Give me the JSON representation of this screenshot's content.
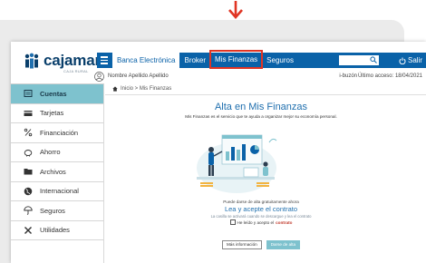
{
  "brand": {
    "name": "cajamar",
    "subtitle": "CAJA RURAL"
  },
  "nav": {
    "items": [
      "Banca Electrónica",
      "Broker",
      "Mis Finanzas",
      "Seguros"
    ],
    "logout": "Salir",
    "highlight_color": "#e03524"
  },
  "user": {
    "name": "Nombre Apellido Apellido",
    "ibuzon": "i-buzón",
    "last_access": "Último acceso: 18/04/2021"
  },
  "sidebar": {
    "items": [
      {
        "label": "Cuentas",
        "icon": "wallet-icon",
        "active": true
      },
      {
        "label": "Tarjetas",
        "icon": "card-icon"
      },
      {
        "label": "Financiación",
        "icon": "percent-icon"
      },
      {
        "label": "Ahorro",
        "icon": "piggy-bank-icon"
      },
      {
        "label": "Archivos",
        "icon": "folder-icon"
      },
      {
        "label": "Internacional",
        "icon": "globe-icon"
      },
      {
        "label": "Seguros",
        "icon": "umbrella-icon"
      },
      {
        "label": "Utilidades",
        "icon": "tools-icon"
      }
    ]
  },
  "breadcrumb": "Inicio > Mis Finanzas",
  "main": {
    "title": "Alta en Mis Finanzas",
    "subtitle": "Mis Finanzas es el servicio que te ayuda a organizar mejor su economía personal.",
    "free_text": "Puede darse de alta gratuitamente ahora",
    "contract_link": "Lea y acepte el contrato",
    "contract_note": "La casilla se activará cuando se descargue y lea el contrato",
    "accept_text": "He leído y acepto el",
    "accept_link": "contrato",
    "more_info_button": "Más información",
    "signup_button": "Darse de alta"
  },
  "colors": {
    "primary": "#0a62a8",
    "accent": "#7ec2ce",
    "brand_text": "#0a3f6b",
    "arrow": "#e03524"
  }
}
